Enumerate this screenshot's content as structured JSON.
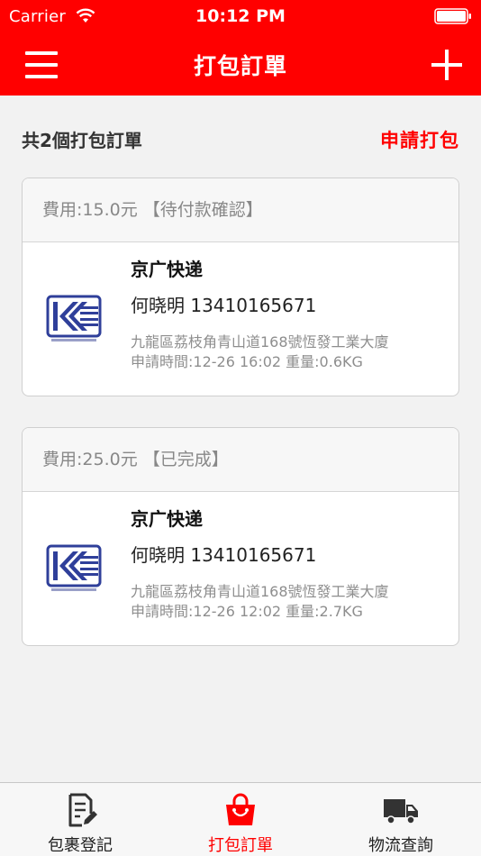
{
  "status_bar": {
    "carrier": "Carrier",
    "time": "10:12 PM"
  },
  "nav": {
    "title": "打包訂單"
  },
  "summary": {
    "count_text": "共2個打包訂單",
    "apply_label": "申請打包"
  },
  "orders": [
    {
      "fee_status": "費用:15.0元 【待付款確認】",
      "courier": "京广快递",
      "contact": "何晓明 13410165671",
      "address": "九龍區荔枝角青山道168號恆發工業大廈",
      "meta": "申請時間:12-26 16:02 重量:0.6KG"
    },
    {
      "fee_status": "費用:25.0元 【已完成】",
      "courier": "京广快递",
      "contact": "何晓明 13410165671",
      "address": "九龍區荔枝角青山道168號恆發工業大廈",
      "meta": "申請時間:12-26 12:02 重量:2.7KG"
    }
  ],
  "tabs": [
    {
      "label": "包裹登記",
      "icon": "edit-document-icon"
    },
    {
      "label": "打包訂單",
      "icon": "shopping-bag-icon",
      "active": true
    },
    {
      "label": "物流查詢",
      "icon": "delivery-truck-icon"
    }
  ],
  "colors": {
    "accent": "#ff0000",
    "background": "#f2f2f2"
  }
}
